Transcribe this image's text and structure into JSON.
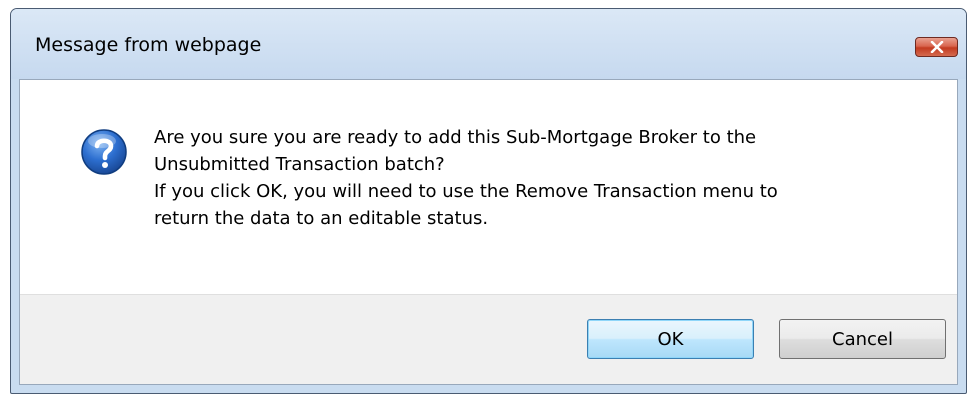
{
  "dialog": {
    "title": "Message from webpage",
    "close_label": "Close",
    "icon": "question-icon",
    "message_lines": [
      "Are you sure you are ready to add this Sub-Mortgage Broker to the",
      "Unsubmitted Transaction batch?",
      "If you click OK, you will need to use the Remove Transaction menu to",
      "return the data to an editable status."
    ],
    "buttons": {
      "ok_label": "OK",
      "cancel_label": "Cancel"
    }
  },
  "colors": {
    "titlebar": "#c9dcf0",
    "close_button": "#c33a20",
    "icon": "#1f58b3"
  }
}
